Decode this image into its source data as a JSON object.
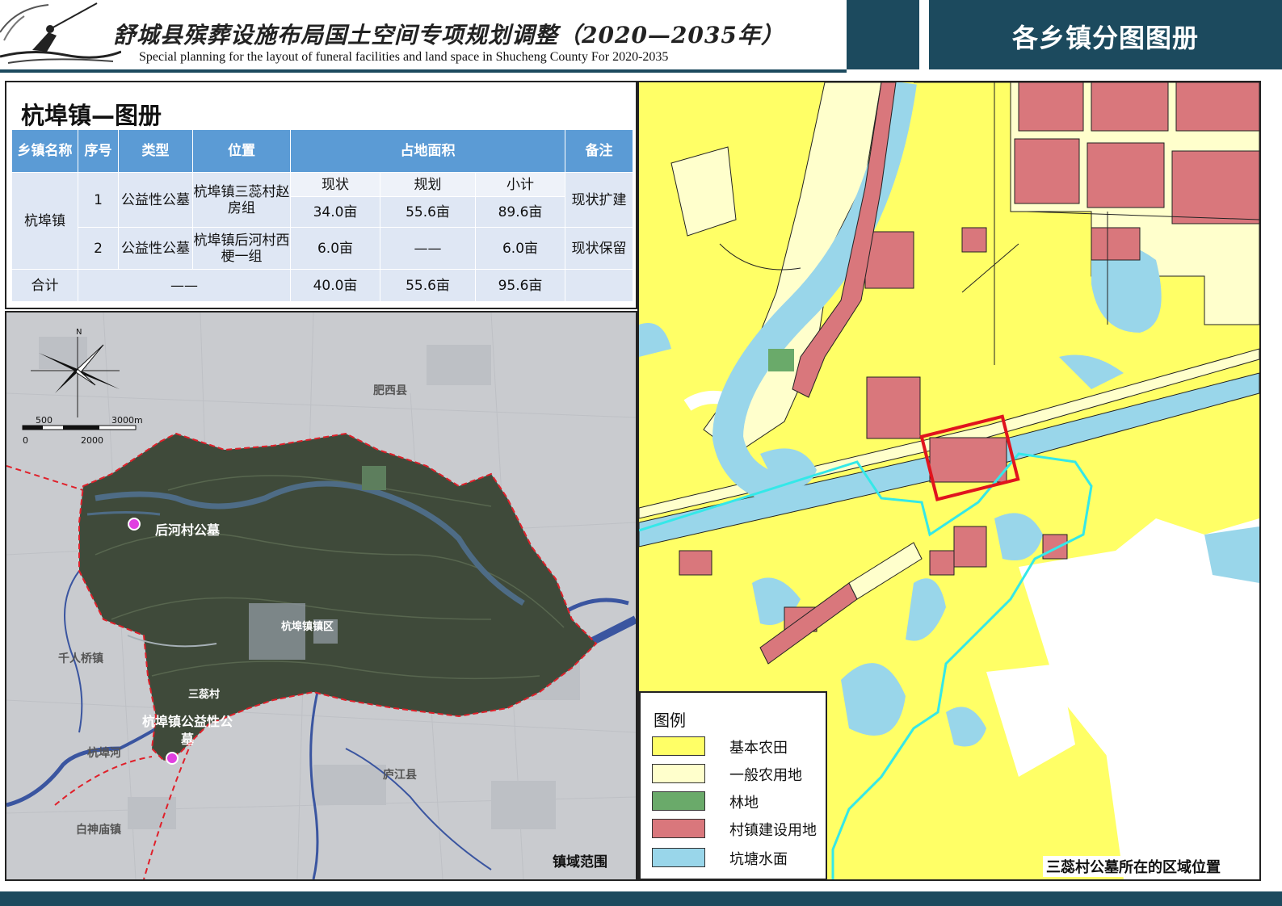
{
  "header": {
    "title": "舒城县殡葬设施布局国土空间专项规划调整（2020—2035年）",
    "subtitle": "Special planning for the layout of funeral facilities and land space in Shucheng County For 2020-2035",
    "right_title": "各乡镇分图图册"
  },
  "table_panel": {
    "title": "杭埠镇—图册",
    "headers": {
      "town": "乡镇名称",
      "seq": "序号",
      "type": "类型",
      "location": "位置",
      "area": "占地面积",
      "remark": "备注"
    },
    "sub_headers": {
      "current": "现状",
      "planned": "规划",
      "subtotal": "小计"
    },
    "town_name": "杭埠镇",
    "rows": [
      {
        "seq": "1",
        "type": "公益性公墓",
        "location": "杭埠镇三蕊村赵房组",
        "current": "34.0亩",
        "planned": "55.6亩",
        "subtotal": "89.6亩",
        "remark": "现状扩建"
      },
      {
        "seq": "2",
        "type": "公益性公墓",
        "location": "杭埠镇后河村西梗一组",
        "current": "6.0亩",
        "planned": "——",
        "subtotal": "6.0亩",
        "remark": "现状保留"
      }
    ],
    "total": {
      "label": "合计",
      "dash": "——",
      "current": "40.0亩",
      "planned": "55.6亩",
      "subtotal": "95.6亩"
    }
  },
  "town_map": {
    "caption": "镇域范围",
    "north_label": "N",
    "scale": {
      "top_left": "500",
      "top_right": "3000m",
      "bottom_left": "0",
      "bottom_mid": "2000"
    },
    "labels": {
      "feixi": "肥西县",
      "houhe_cemetery": "后河村公墓",
      "town_area": "杭埠镇镇区",
      "qianrenqiao": "千人桥镇",
      "sanrui": "三蕊村",
      "hangbu_cemetery": "杭埠镇公益性公墓",
      "hangbu_river": "杭埠河",
      "lujiang": "庐江县",
      "baishenmiao": "白神庙镇"
    }
  },
  "landuse_map": {
    "caption": "三蕊村公墓所在的区域位置",
    "legend_title": "图例",
    "legend": [
      {
        "label": "基本农田",
        "color": "#ffff66"
      },
      {
        "label": "一般农用地",
        "color": "#ffffcc"
      },
      {
        "label": "林地",
        "color": "#6aaa6a"
      },
      {
        "label": "村镇建设用地",
        "color": "#d9777c"
      },
      {
        "label": "坑塘水面",
        "color": "#99d6ea"
      }
    ]
  }
}
